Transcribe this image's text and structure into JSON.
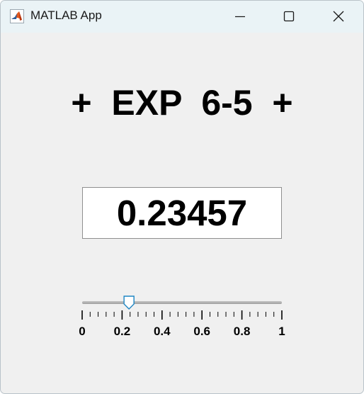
{
  "window": {
    "title": "MATLAB App",
    "icon": "matlab-logo-icon",
    "controls": [
      "minimize-icon",
      "maximize-icon",
      "close-icon"
    ]
  },
  "main": {
    "heading": "+  EXP  6-5  +",
    "value_display": "0.23457"
  },
  "slider": {
    "value": 0.23457,
    "min": 0,
    "max": 1,
    "major_tick_labels": [
      "0",
      "0.2",
      "0.4",
      "0.6",
      "0.8",
      "1"
    ],
    "major_tick_values": [
      0,
      0.2,
      0.4,
      0.6,
      0.8,
      1
    ],
    "minor_ticks_per_major": 4
  },
  "colors": {
    "titlebar": "#eaf3f6",
    "background": "#f0f0f0",
    "thumb_border": "#1f86c4"
  }
}
